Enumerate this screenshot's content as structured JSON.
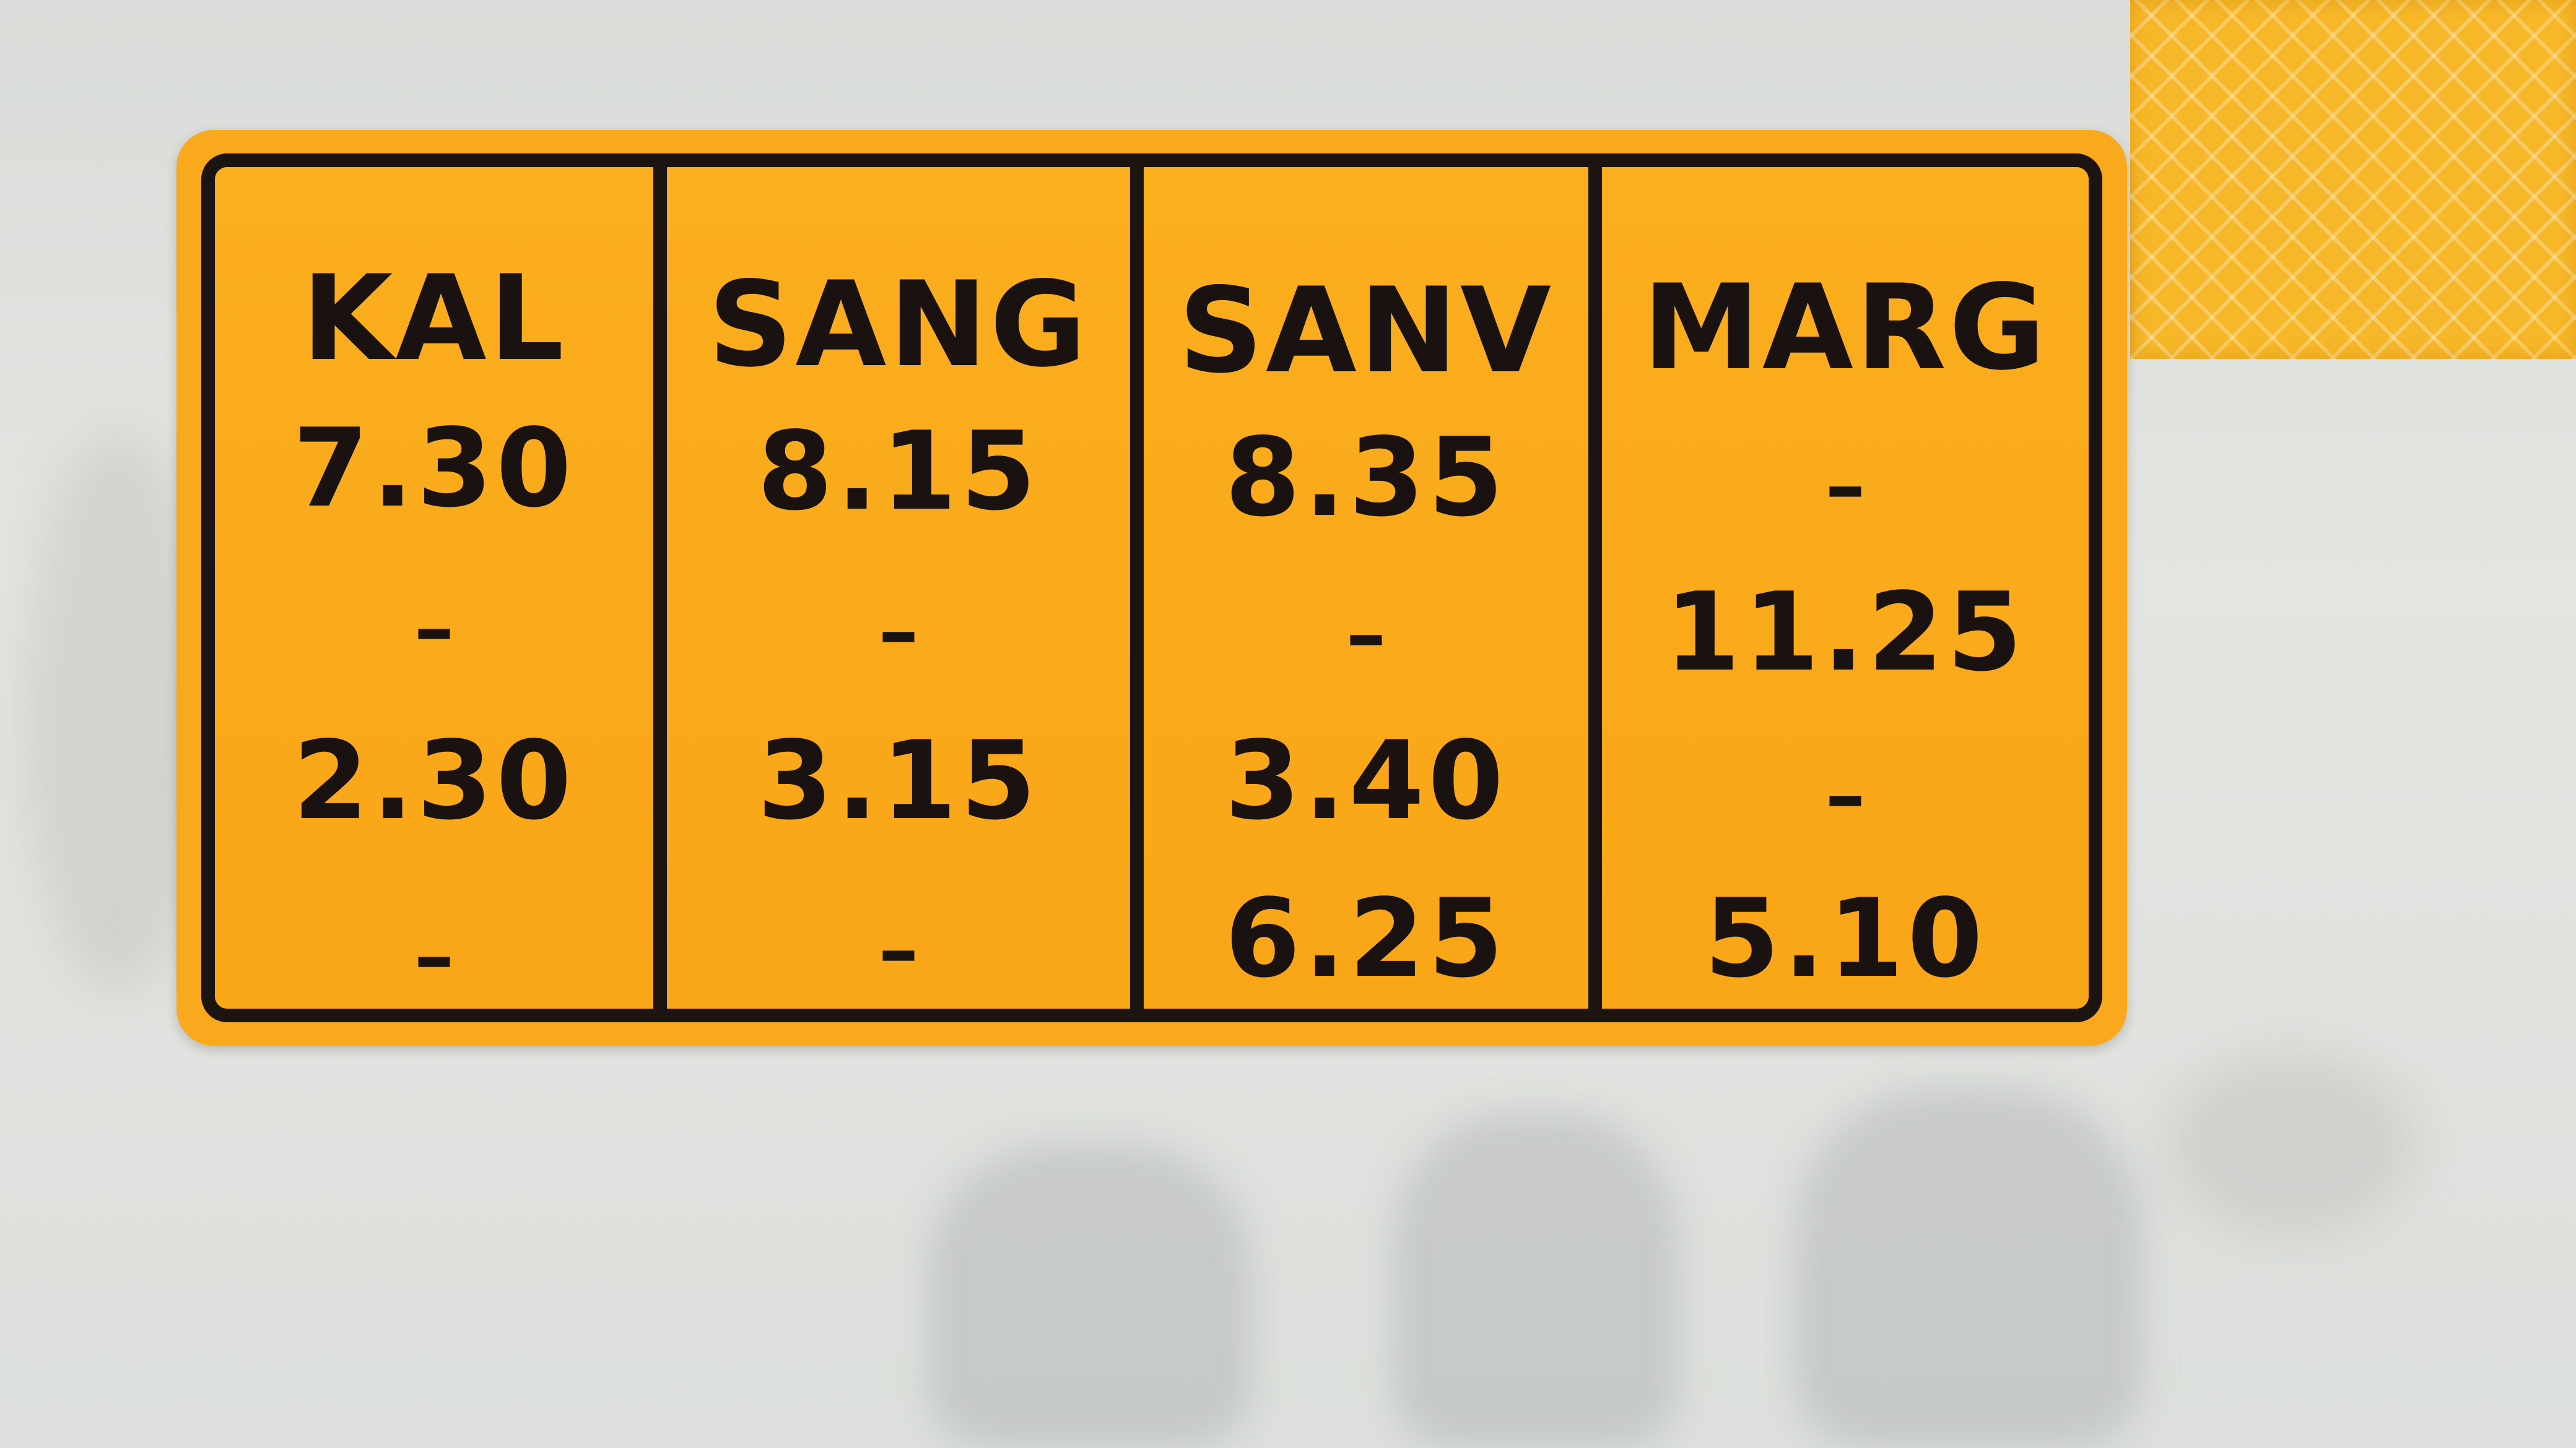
{
  "sign": {
    "columns": [
      {
        "label": "KAL",
        "rows": [
          "7.30",
          "–",
          "2.30",
          "–"
        ]
      },
      {
        "label": "SANG",
        "rows": [
          "8.15",
          "–",
          "3.15",
          "–"
        ]
      },
      {
        "label": "SANV",
        "rows": [
          "8.35",
          "–",
          "3.40",
          "6.25"
        ]
      },
      {
        "label": "MARG",
        "rows": [
          "–",
          "11.25",
          "–",
          "5.10"
        ]
      }
    ],
    "colors": {
      "background": "#f9a91b",
      "border": "#1c1410",
      "text": "#1a1210",
      "wall": "#e0e2de",
      "reflector": "#f6b728"
    }
  }
}
